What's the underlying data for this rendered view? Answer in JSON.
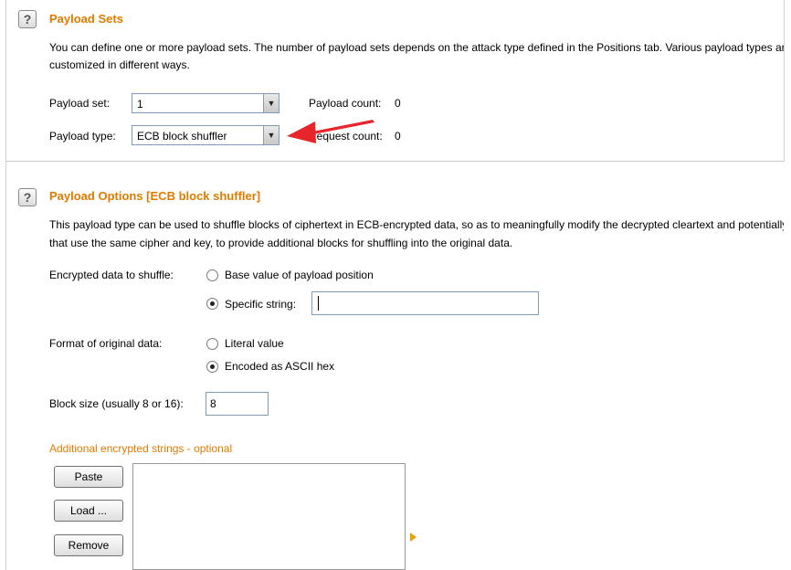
{
  "payload_sets": {
    "help_icon": "?",
    "title": "Payload Sets",
    "description_line1": "You can define one or more payload sets. The number of payload sets depends on the attack type defined in the Positions tab. Various payload types are available for each payload set, and each payload type can be",
    "description_line2": "customized in different ways.",
    "payload_set_label": "Payload set:",
    "payload_set_value": "1",
    "payload_count_label": "Payload count:",
    "payload_count_value": "0",
    "payload_type_label": "Payload type:",
    "payload_type_value": "ECB block shuffler",
    "request_count_label": "Request count:",
    "request_count_value": "0",
    "dropdown_glyph": "▼"
  },
  "payload_options": {
    "help_icon": "?",
    "title": "Payload Options [ECB block shuffler]",
    "description_line1": "This payload type can be used to shuffle blocks of ciphertext in ECB-encrypted data, so as to meaningfully modify the decrypted cleartext and potentially interfere with application logic. You can specify other strings",
    "description_line2": "that use the same cipher and key, to provide additional blocks for shuffling into the original data.",
    "encrypted_data_label": "Encrypted data to shuffle:",
    "option_base_value": "Base value of payload position",
    "option_specific_string": "Specific string:",
    "specific_string_value": "",
    "format_label": "Format of original data:",
    "option_literal": "Literal value",
    "option_ascii_hex": "Encoded as ASCII hex",
    "block_size_label": "Block size (usually 8 or 16):",
    "block_size_value": "8",
    "additional_title": "Additional encrypted strings - optional",
    "paste_label": "Paste",
    "load_label": "Load ...",
    "remove_label": "Remove"
  },
  "annotation": {
    "arrow_color": "#e8252b"
  },
  "colors": {
    "section_title": "#e07b00",
    "expand_arrow": "#e8a200"
  }
}
